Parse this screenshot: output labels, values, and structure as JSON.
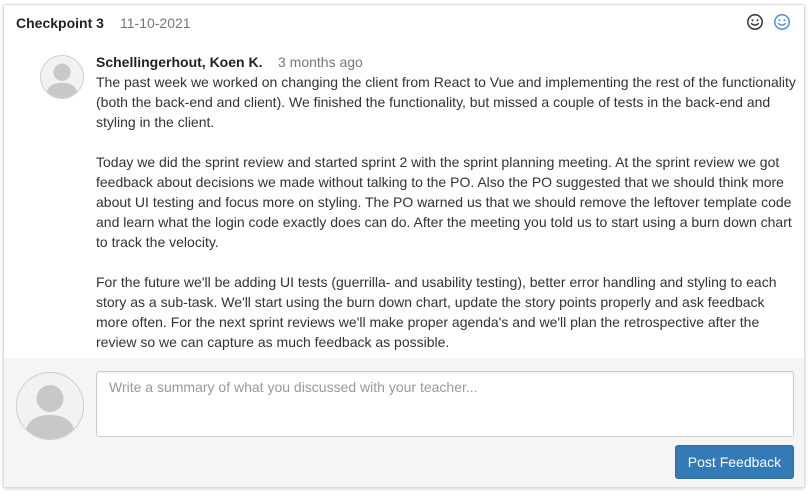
{
  "header": {
    "title": "Checkpoint 3",
    "date": "11-10-2021",
    "icons": [
      "smiley-icon",
      "smiley-icon-active"
    ],
    "accent_color": "#4a90d9"
  },
  "comment": {
    "author": "Schellingerhout, Koen K.",
    "time_ago": "3 months ago",
    "paragraphs": [
      "The past week we worked on changing the client from React to Vue and implementing the rest of the functionality (both the back-end and client). We finished the functionality, but missed a couple of tests in the back-end and styling in the client.",
      "Today we did the sprint review and started sprint 2 with the sprint planning meeting. At the sprint review we got feedback about decisions we made without talking to the PO. Also the PO suggested that we should think more about UI testing and focus more on styling. The PO warned us that we should remove the leftover template code and learn what the login code exactly does can do. After the meeting you told us to start using a burn down chart to track the velocity.",
      "For the future we'll be adding UI tests (guerrilla- and usability testing), better error handling and styling to each story as a sub-task. We'll start using the burn down chart, update the story points properly and ask feedback more often. For the next sprint reviews we'll make proper agenda's and we'll plan the retrospective after the review so we can capture as much feedback as possible."
    ]
  },
  "reply": {
    "placeholder": "Write a summary of what you discussed with your teacher...",
    "value": "",
    "submit_label": "Post Feedback",
    "submit_color": "#337ab7"
  }
}
